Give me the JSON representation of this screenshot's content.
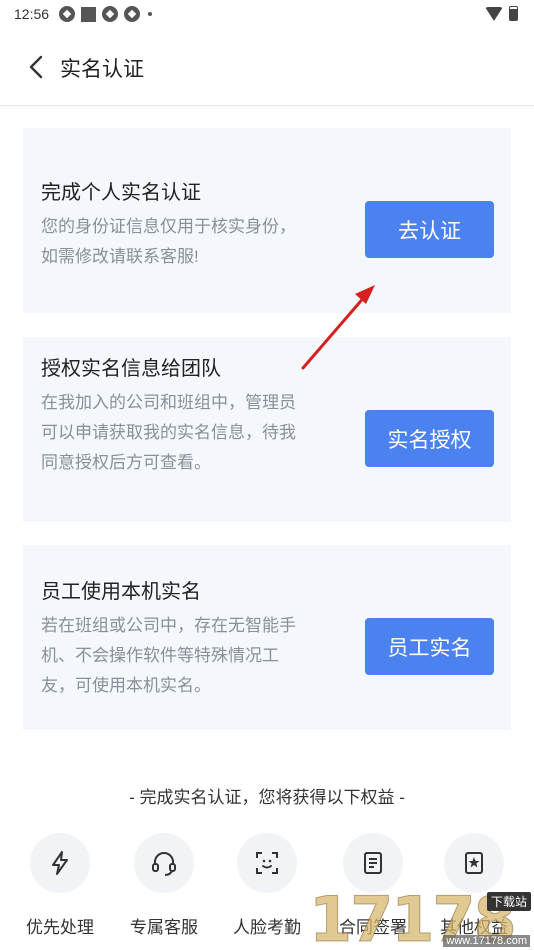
{
  "status_bar": {
    "time": "12:56"
  },
  "header": {
    "title": "实名认证"
  },
  "cards": [
    {
      "title": "完成个人实名认证",
      "desc": "您的身份证信息仅用于核实身份，如需修改请联系客服!",
      "button": "去认证"
    },
    {
      "title": "授权实名信息给团队",
      "desc": "在我加入的公司和班组中，管理员可以申请获取我的实名信息，待我同意授权后方可查看。",
      "button": "实名授权"
    },
    {
      "title": "员工使用本机实名",
      "desc": "若在班组或公司中，存在无智能手机、不会操作软件等特殊情况工友，可使用本机实名。",
      "button": "员工实名"
    }
  ],
  "benefits": {
    "heading": "- 完成实名认证，您将获得以下权益 -",
    "items": [
      {
        "label": "优先处理",
        "icon": "lightning-icon"
      },
      {
        "label": "专属客服",
        "icon": "headset-icon"
      },
      {
        "label": "人脸考勤",
        "icon": "face-scan-icon"
      },
      {
        "label": "合同签署",
        "icon": "contract-icon"
      },
      {
        "label": "其他权益",
        "icon": "bookmark-star-icon"
      }
    ]
  },
  "colors": {
    "accent": "#4b82f0",
    "card_bg": "#f4f8fd",
    "arrow": "#d62020"
  },
  "watermark": {
    "number": "17178",
    "tag": "下载站",
    "url": "www.17178.com"
  }
}
